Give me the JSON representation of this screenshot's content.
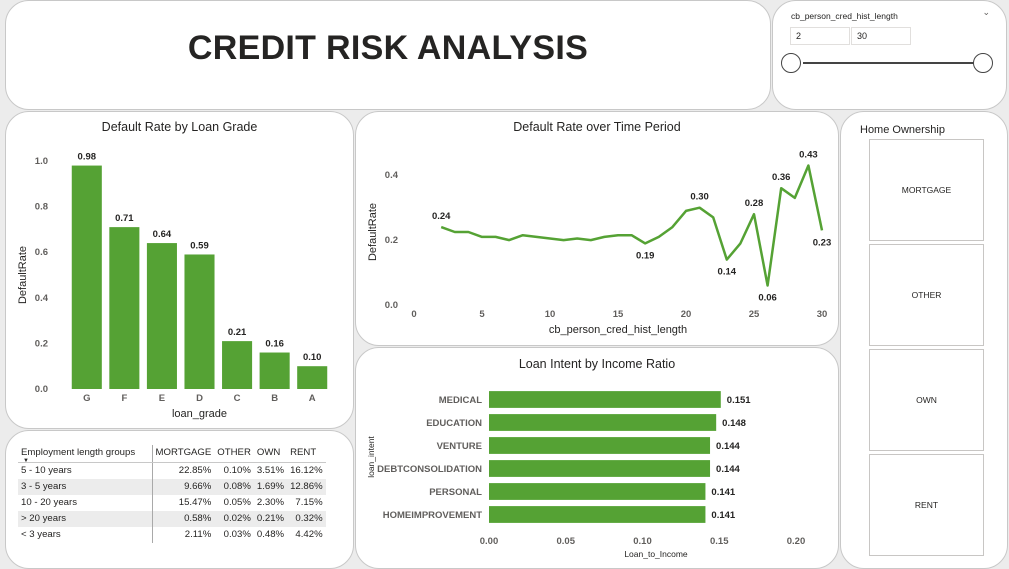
{
  "header": {
    "title": "CREDIT RISK ANALYSIS"
  },
  "slicer": {
    "field": "cb_person_cred_hist_length",
    "min_value": "2",
    "max_value": "30",
    "range": [
      2,
      30
    ],
    "selected": [
      2,
      30
    ],
    "chevron_icon": "chevron-down-icon"
  },
  "home_ownership": {
    "title": "Home Ownership",
    "options": [
      "MORTGAGE",
      "OTHER",
      "OWN",
      "RENT"
    ]
  },
  "employment_table": {
    "columns": [
      "Employment length groups",
      "MORTGAGE",
      "OTHER",
      "OWN",
      "RENT"
    ],
    "rows": [
      [
        "5 - 10 years",
        "22.85%",
        "0.10%",
        "3.51%",
        "16.12%"
      ],
      [
        "3 - 5 years",
        "9.66%",
        "0.08%",
        "1.69%",
        "12.86%"
      ],
      [
        "10 - 20 years",
        "15.47%",
        "0.05%",
        "2.30%",
        "7.15%"
      ],
      [
        "> 20 years",
        "0.58%",
        "0.02%",
        "0.21%",
        "0.32%"
      ],
      [
        "< 3 years",
        "2.11%",
        "0.03%",
        "0.48%",
        "4.42%"
      ]
    ]
  },
  "colors": {
    "bar": "#55a234",
    "line": "#55a234",
    "text": "#252423",
    "axis_text": "#605e5c",
    "grid": "#e8e8e8"
  },
  "chart_data": [
    {
      "id": "grade",
      "type": "bar",
      "title": "Default Rate by Loan Grade",
      "xlabel": "loan_grade",
      "ylabel": "DefaultRate",
      "categories": [
        "G",
        "F",
        "E",
        "D",
        "C",
        "B",
        "A"
      ],
      "values": [
        0.98,
        0.71,
        0.64,
        0.59,
        0.21,
        0.16,
        0.1
      ],
      "data_labels": [
        "0.98",
        "0.71",
        "0.64",
        "0.59",
        "0.21",
        "0.16",
        "0.10"
      ],
      "ylim": [
        0,
        1.0
      ],
      "yticks": [
        "0.0",
        "0.2",
        "0.4",
        "0.6",
        "0.8",
        "1.0"
      ],
      "grid": false
    },
    {
      "id": "time",
      "type": "line",
      "title": "Default Rate over Time Period",
      "xlabel": "cb_person_cred_hist_length",
      "ylabel": "DefaultRate",
      "x": [
        2,
        3,
        4,
        5,
        6,
        7,
        8,
        9,
        10,
        11,
        12,
        13,
        14,
        15,
        16,
        17,
        18,
        19,
        20,
        21,
        22,
        23,
        24,
        25,
        26,
        27,
        28,
        29,
        30
      ],
      "y": [
        0.24,
        0.225,
        0.225,
        0.21,
        0.21,
        0.2,
        0.215,
        0.21,
        0.205,
        0.2,
        0.205,
        0.2,
        0.21,
        0.215,
        0.215,
        0.19,
        0.21,
        0.24,
        0.29,
        0.3,
        0.27,
        0.14,
        0.19,
        0.28,
        0.06,
        0.36,
        0.33,
        0.43,
        0.23
      ],
      "point_labels": [
        {
          "x": 2,
          "label": "0.24"
        },
        {
          "x": 17,
          "label": "0.19"
        },
        {
          "x": 21,
          "label": "0.30"
        },
        {
          "x": 23,
          "label": "0.14"
        },
        {
          "x": 25,
          "label": "0.28"
        },
        {
          "x": 26,
          "label": "0.06"
        },
        {
          "x": 27,
          "label": "0.36"
        },
        {
          "x": 29,
          "label": "0.43"
        },
        {
          "x": 30,
          "label": "0.23"
        }
      ],
      "xlim": [
        0,
        30
      ],
      "ylim": [
        0,
        0.45
      ],
      "xticks": [
        0,
        5,
        10,
        15,
        20,
        25,
        30
      ],
      "yticks": [
        {
          "v": 0.0,
          "label": "0.0"
        },
        {
          "v": 0.2,
          "label": "0.2"
        },
        {
          "v": 0.4,
          "label": "0.4"
        }
      ],
      "grid": false
    },
    {
      "id": "intent",
      "type": "bar",
      "orientation": "horizontal",
      "title": "Loan Intent by Income Ratio",
      "xlabel": "Loan_to_Income",
      "ylabel": "loan_intent",
      "categories": [
        "MEDICAL",
        "EDUCATION",
        "VENTURE",
        "DEBTCONSOLIDATION",
        "PERSONAL",
        "HOMEIMPROVEMENT"
      ],
      "values": [
        0.151,
        0.148,
        0.144,
        0.144,
        0.141,
        0.141
      ],
      "data_labels": [
        "0.151",
        "0.148",
        "0.144",
        "0.144",
        "0.141",
        "0.141"
      ],
      "xlim": [
        0,
        0.2
      ],
      "xticks": [
        "0.00",
        "0.05",
        "0.10",
        "0.15",
        "0.20"
      ],
      "grid": false
    }
  ]
}
